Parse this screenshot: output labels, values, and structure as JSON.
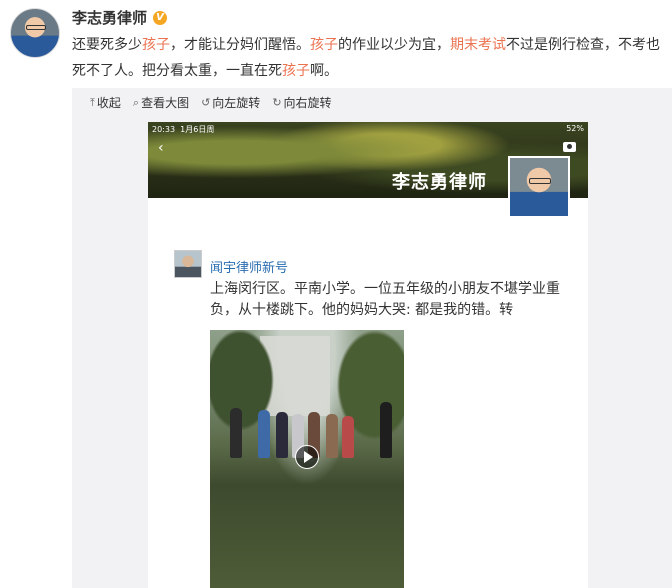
{
  "post": {
    "author": "李志勇律师",
    "verified_badge": "V",
    "text_segments": [
      {
        "text": "还要死多少",
        "hl": false
      },
      {
        "text": "孩子",
        "hl": true
      },
      {
        "text": "，才能让分妈们醒悟。",
        "hl": false
      },
      {
        "text": "孩子",
        "hl": true
      },
      {
        "text": "的作业以少为宜，",
        "hl": false
      },
      {
        "text": "期末考试",
        "hl": true
      },
      {
        "text": "不过是例行检查，不考也死不了人。把分看太重，一直在死",
        "hl": false
      },
      {
        "text": "孩子",
        "hl": true
      },
      {
        "text": "啊。",
        "hl": false
      }
    ],
    "highlight_color": "#eb7350"
  },
  "toolbar": {
    "collapse": {
      "icon": "arrow-up-icon",
      "glyph": "⤒",
      "label": "收起"
    },
    "view_large": {
      "icon": "magnifier-icon",
      "glyph": "⌕",
      "label": "查看大图"
    },
    "rotate_left": {
      "icon": "rotate-left-icon",
      "glyph": "↺",
      "label": "向左旋转"
    },
    "rotate_right": {
      "icon": "rotate-right-icon",
      "glyph": "↻",
      "label": "向右旋转"
    }
  },
  "screenshot": {
    "status_time": "20:33",
    "status_date": "1月6日周",
    "status_battery": "52%",
    "back_glyph": "‹",
    "cover_name": "李志勇律师",
    "repost_author": "闻宇律师新号",
    "repost_text": "上海闵行区。平南小学。一位五年级的小朋友不堪学业重负，从十楼跳下。他的妈妈大哭: 都是我的错。转"
  }
}
